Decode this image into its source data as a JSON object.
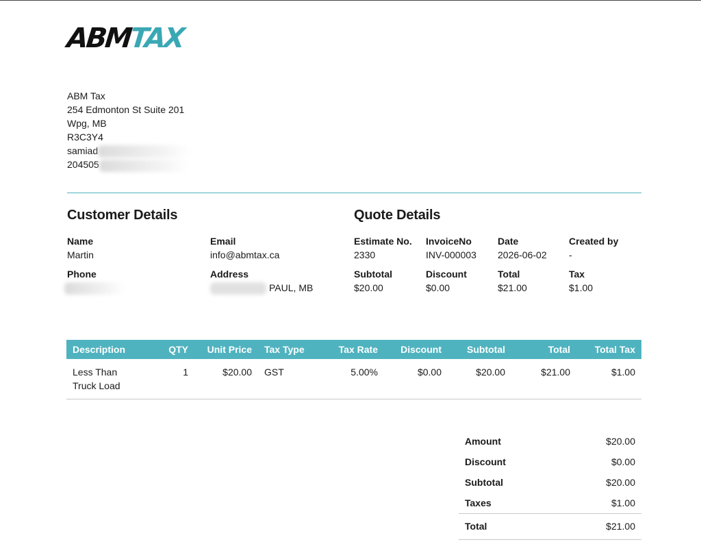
{
  "logo": {
    "part1": "ABM",
    "part2": "TAX"
  },
  "company": {
    "name": "ABM Tax",
    "address": "254 Edmonton St Suite 201",
    "city": "Wpg, MB",
    "postal": "R3C3Y4",
    "email_partial": "samiad",
    "phone_partial": "204505"
  },
  "customer": {
    "title": "Customer Details",
    "name_label": "Name",
    "name": "Martin",
    "email_label": "Email",
    "email": "info@abmtax.ca",
    "phone_label": "Phone",
    "address_label": "Address",
    "address_partial": "PAUL, MB"
  },
  "quote": {
    "title": "Quote Details",
    "estimate_label": "Estimate No.",
    "estimate": "2330",
    "invoice_label": "InvoiceNo",
    "invoice": "INV-000003",
    "date_label": "Date",
    "date": "2026-06-02",
    "created_label": "Created by",
    "created": "-",
    "subtotal_label": "Subtotal",
    "subtotal": "$20.00",
    "discount_label": "Discount",
    "discount": "$0.00",
    "total_label": "Total",
    "total": "$21.00",
    "tax_label": "Tax",
    "tax": "$1.00"
  },
  "items_table": {
    "headers": [
      "Description",
      "QTY",
      "Unit Price",
      "Tax Type",
      "Tax Rate",
      "Discount",
      "Subtotal",
      "Total",
      "Total Tax"
    ],
    "rows": [
      {
        "description_line1": "Less Than",
        "description_line2": "Truck Load",
        "qty": "1",
        "unit_price": "$20.00",
        "tax_type": "GST",
        "tax_rate": "5.00%",
        "discount": "$0.00",
        "subtotal": "$20.00",
        "total": "$21.00",
        "total_tax": "$1.00"
      }
    ]
  },
  "summary": {
    "amount_label": "Amount",
    "amount": "$20.00",
    "discount_label": "Discount",
    "discount": "$0.00",
    "subtotal_label": "Subtotal",
    "subtotal": "$20.00",
    "taxes_label": "Taxes",
    "taxes": "$1.00",
    "total_label": "Total",
    "total": "$21.00"
  },
  "colors": {
    "accent": "#4fb3bf",
    "logo_dark": "#111111",
    "logo_accent": "#3aa8b4"
  }
}
